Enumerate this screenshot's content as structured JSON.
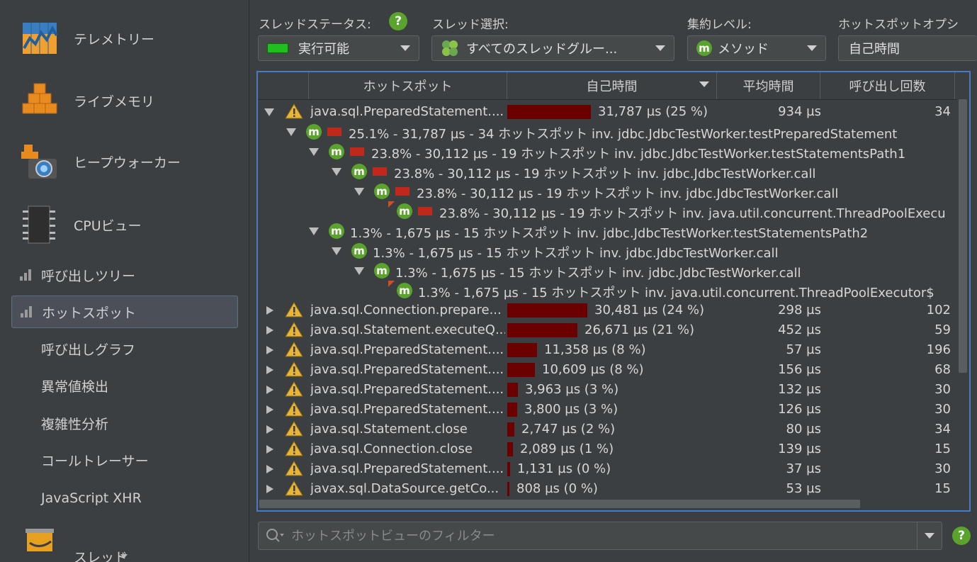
{
  "sidebar": {
    "big_items": [
      {
        "label": "テレメトリー",
        "icon": "telemetry-icon"
      },
      {
        "label": "ライブメモリ",
        "icon": "live-memory-icon"
      },
      {
        "label": "ヒープウォーカー",
        "icon": "heap-walker-icon"
      },
      {
        "label": "CPUビュー",
        "icon": "cpu-icon"
      }
    ],
    "sub_items": [
      {
        "label": "呼び出しツリー"
      },
      {
        "label": "ホットスポット"
      },
      {
        "label": "呼び出しグラフ"
      },
      {
        "label": "異常値検出"
      },
      {
        "label": "複雑性分析"
      },
      {
        "label": "コールトレーサー"
      },
      {
        "label": "JavaScript XHR"
      }
    ],
    "cut_item": {
      "label": "スレッド"
    }
  },
  "toolbar": {
    "thread_status_label": "スレッドステータス:",
    "thread_status_value": "実行可能",
    "thread_select_label": "スレッド選択:",
    "thread_select_value": "すべてのスレッドグルー...",
    "aggregation_label": "集約レベル:",
    "aggregation_value": "メソッド",
    "hotspot_option_label": "ホットスポットオプシ",
    "hotspot_option_value": "自己時間",
    "help": "?"
  },
  "table": {
    "columns": {
      "hotspot": "ホットスポット",
      "self_time": "自己時間",
      "avg_time": "平均時間",
      "calls": "呼び出し回数"
    },
    "rows": [
      {
        "name": "java.sql.PreparedStatement....",
        "self": "31,787 µs (25 %)",
        "avg": "934 µs",
        "calls": "34",
        "share": 0.25
      },
      {
        "name": "java.sql.Connection.prepare...",
        "self": "30,481 µs (24 %)",
        "avg": "298 µs",
        "calls": "102",
        "share": 0.24
      },
      {
        "name": "java.sql.Statement.executeQ...",
        "self": "26,671 µs (21 %)",
        "avg": "452 µs",
        "calls": "59",
        "share": 0.21
      },
      {
        "name": "java.sql.PreparedStatement....",
        "self": "11,358 µs (8 %)",
        "avg": "57 µs",
        "calls": "196",
        "share": 0.089
      },
      {
        "name": "java.sql.PreparedStatement....",
        "self": "10,609 µs (8 %)",
        "avg": "156 µs",
        "calls": "68",
        "share": 0.083
      },
      {
        "name": "java.sql.PreparedStatement....",
        "self": "3,963 µs (3 %)",
        "avg": "132 µs",
        "calls": "30",
        "share": 0.031
      },
      {
        "name": "java.sql.PreparedStatement....",
        "self": "3,800 µs (3 %)",
        "avg": "126 µs",
        "calls": "30",
        "share": 0.03
      },
      {
        "name": "java.sql.Statement.close",
        "self": "2,747 µs (2 %)",
        "avg": "80 µs",
        "calls": "34",
        "share": 0.021
      },
      {
        "name": "java.sql.Connection.close",
        "self": "2,089 µs (1 %)",
        "avg": "139 µs",
        "calls": "15",
        "share": 0.016
      },
      {
        "name": "java.sql.PreparedStatement....",
        "self": "1,131 µs (0 %)",
        "avg": "37 µs",
        "calls": "30",
        "share": 0.009
      },
      {
        "name": "javax.sql.DataSource.getCo...",
        "self": "808 µs (0 %)",
        "avg": "53 µs",
        "calls": "15",
        "share": 0.006
      }
    ],
    "backtraces": [
      {
        "text": "25.1% - 31,787 µs - 34 ホットスポット inv. jdbc.JdbcTestWorker.testPreparedStatement"
      },
      {
        "text": "23.8% - 30,112 µs - 19 ホットスポット inv. jdbc.JdbcTestWorker.testStatementsPath1"
      },
      {
        "text": "23.8% - 30,112 µs - 19 ホットスポット inv. jdbc.JdbcTestWorker.call"
      },
      {
        "text": "23.8% - 30,112 µs - 19 ホットスポット inv. jdbc.JdbcTestWorker.call"
      },
      {
        "text": "23.8% - 30,112 µs - 19 ホットスポット inv. java.util.concurrent.ThreadPoolExecu"
      },
      {
        "text": "1.3% - 1,675 µs - 15 ホットスポット inv. jdbc.JdbcTestWorker.testStatementsPath2"
      },
      {
        "text": "1.3% - 1,675 µs - 15 ホットスポット inv. jdbc.JdbcTestWorker.call"
      },
      {
        "text": "1.3% - 1,675 µs - 15 ホットスポット inv. jdbc.JdbcTestWorker.call"
      },
      {
        "text": "1.3% - 1,675 µs - 15 ホットスポット inv. java.util.concurrent.ThreadPoolExecutor$"
      }
    ],
    "method_icon_letter": "m"
  },
  "filter": {
    "placeholder": "ホットスポットビューのフィルター"
  },
  "colors": {
    "accent_blue": "#4a7bbf",
    "bar_dark_red": "#6b0000",
    "bar_red": "#c0281b",
    "green": "#5aa32c",
    "warning": "#e8b43a"
  }
}
